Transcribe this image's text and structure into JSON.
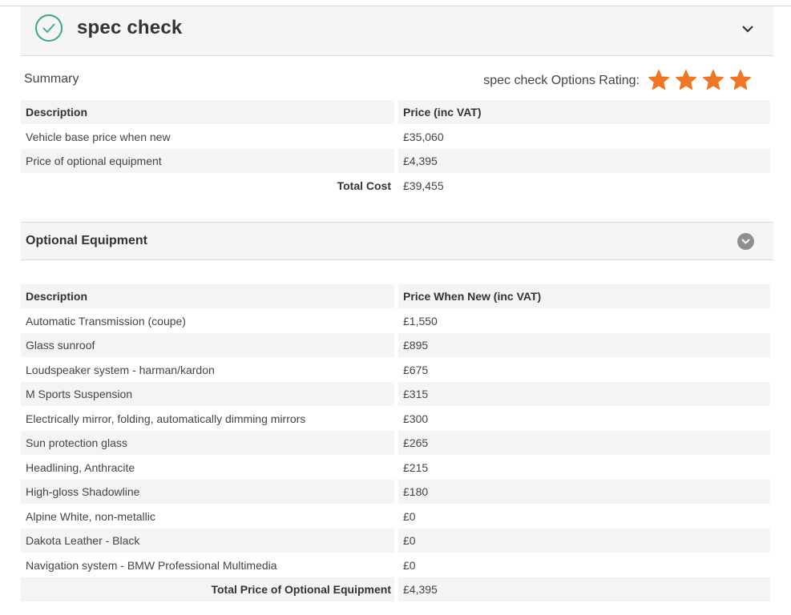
{
  "header": {
    "title": "spec check",
    "check_icon": "check-circle-icon",
    "toggle_icon": "chevron-down-icon",
    "accent_color": "#3aa682"
  },
  "summary": {
    "label": "Summary",
    "rating_label": "spec check Options Rating:",
    "rating_stars": 4,
    "star_color": "#ee7624",
    "table": {
      "headers": {
        "description": "Description",
        "price": "Price (inc VAT)"
      },
      "rows": [
        {
          "description": "Vehicle base price when new",
          "price": "£35,060"
        },
        {
          "description": "Price of optional equipment",
          "price": "£4,395"
        }
      ],
      "total": {
        "label": "Total Cost",
        "value": "£39,455"
      }
    }
  },
  "optional_equipment": {
    "title": "Optional Equipment",
    "toggle_icon": "chevron-down-circle-icon",
    "table": {
      "headers": {
        "description": "Description",
        "price": "Price When New (inc VAT)"
      },
      "rows": [
        {
          "description": "Automatic Transmission (coupe)",
          "price": "£1,550"
        },
        {
          "description": "Glass sunroof",
          "price": "£895"
        },
        {
          "description": "Loudspeaker system - harman/kardon",
          "price": "£675"
        },
        {
          "description": "M Sports Suspension",
          "price": "£315"
        },
        {
          "description": "Electrically mirror, folding, automatically dimming mirrors",
          "price": "£300"
        },
        {
          "description": "Sun protection glass",
          "price": "£265"
        },
        {
          "description": "Headlining, Anthracite",
          "price": "£215"
        },
        {
          "description": "High-gloss Shadowline",
          "price": "£180"
        },
        {
          "description": "Alpine White, non-metallic",
          "price": "£0"
        },
        {
          "description": "Dakota Leather - Black",
          "price": "£0"
        },
        {
          "description": "Navigation system - BMW Professional Multimedia",
          "price": "£0"
        }
      ],
      "total": {
        "label": "Total Price of Optional Equipment",
        "value": "£4,395"
      }
    }
  }
}
